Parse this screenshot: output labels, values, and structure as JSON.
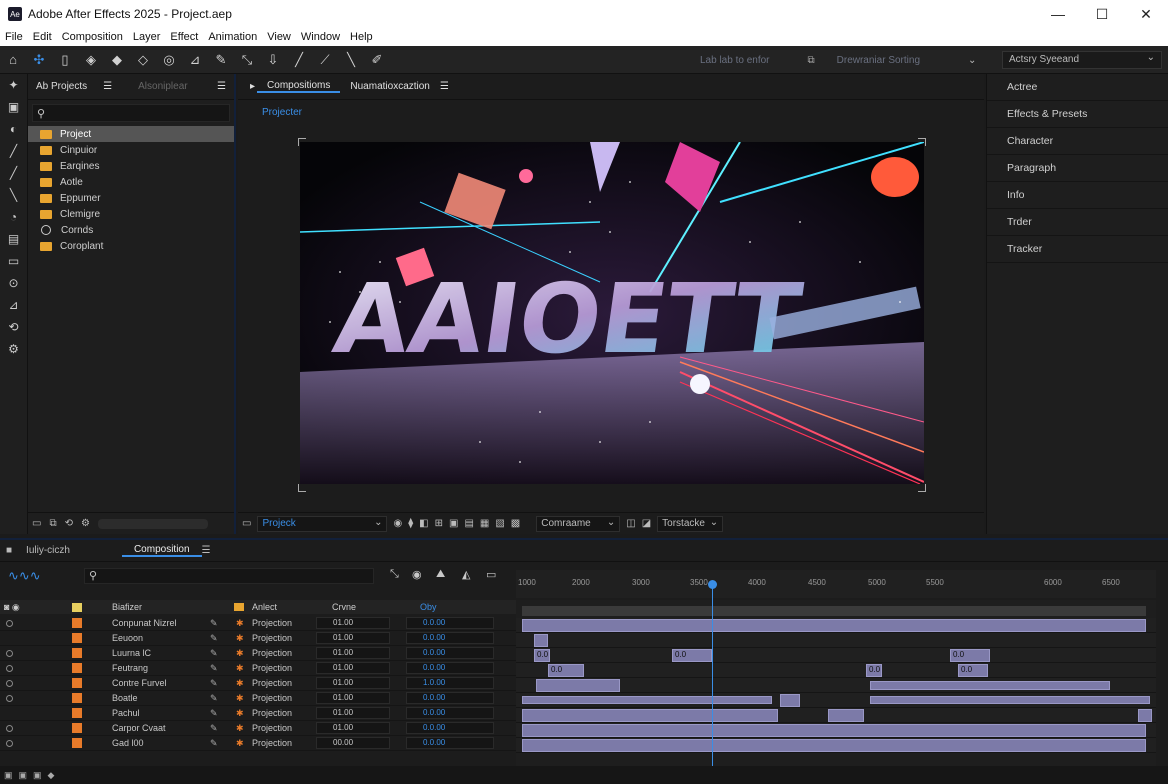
{
  "window": {
    "title": "Adobe After Effects 2025 - Project.aep",
    "logo": "Ae"
  },
  "menu": [
    "File",
    "Edit",
    "Composition",
    "Layer",
    "Effect",
    "Animation",
    "View",
    "Window",
    "Help"
  ],
  "toolbar": {
    "tools": [
      "home-icon",
      "selection-icon",
      "hand-icon",
      "zoom-icon",
      "rotate-icon",
      "camera-icon",
      "pan-behind-icon",
      "rectangle-icon",
      "pen-icon",
      "text-icon",
      "brush-icon",
      "clone-stamp-icon",
      "eraser-icon",
      "roto-brush-icon",
      "puppet-icon"
    ],
    "snap_text": "Lab  lab to enfor",
    "snap_text2": "Drewraniar Sorting",
    "workspace": "Actsry Syeeand"
  },
  "project_panel": {
    "tabs": [
      "Ab Projects",
      "Alsoniplear"
    ],
    "search_placeholder": "",
    "items": [
      {
        "name": "Project",
        "type": "folder",
        "selected": true
      },
      {
        "name": "Cinpuior",
        "type": "folder"
      },
      {
        "name": "Earqines",
        "type": "folder"
      },
      {
        "name": "Aotle",
        "type": "folder"
      },
      {
        "name": "Eppumer",
        "type": "folder"
      },
      {
        "name": "Clemigre",
        "type": "folder"
      },
      {
        "name": "Cornds",
        "type": "circle"
      },
      {
        "name": "Coroplant",
        "type": "folder"
      }
    ]
  },
  "composition_panel": {
    "tabs": [
      "Compositioms",
      "Nuamatioxcaztion"
    ],
    "breadcrumb": "Projecter",
    "bottom": {
      "project_select": "Projeck",
      "comp_select": "Comraame",
      "view_select": "Torstacke"
    }
  },
  "right_panel": {
    "items": [
      "Actree",
      "Effects & Presets",
      "Character",
      "Paragraph",
      "Info",
      "Trder",
      "Tracker"
    ]
  },
  "timeline": {
    "tabs": [
      "Iuliy-ciczh",
      "Composition"
    ],
    "columns": {
      "name": "Biafizer",
      "parent": "Anlect",
      "mode": "Crvne",
      "blend": "Oby"
    },
    "rows": [
      {
        "name": "Conpunat Nizrel",
        "parent": "Projection",
        "mode": "01.00",
        "blend": "0.0.00"
      },
      {
        "name": "Eeuoon",
        "parent": "Projection",
        "mode": "01.00",
        "blend": "0.0.00"
      },
      {
        "name": "Luurna lC",
        "parent": "Projection",
        "mode": "01.00",
        "blend": "0.0.00"
      },
      {
        "name": "Feutrang",
        "parent": "Projection",
        "mode": "01.00",
        "blend": "0.0.00"
      },
      {
        "name": "Contre Furvel",
        "parent": "Projection",
        "mode": "01.00",
        "blend": "1.0.00"
      },
      {
        "name": "Boatle",
        "parent": "Projection",
        "mode": "01.00",
        "blend": "0.0.00"
      },
      {
        "name": "Pachul",
        "parent": "Projection",
        "mode": "01.00",
        "blend": "0.0.00"
      },
      {
        "name": "Carpor Cvaat",
        "parent": "Projection",
        "mode": "01.00",
        "blend": "0.0.00"
      },
      {
        "name": "Gad l00",
        "parent": "Projection",
        "mode": "00.00",
        "blend": "0.0.00"
      }
    ],
    "ruler_ticks": [
      "1000",
      "2000",
      "3000",
      "3500",
      "4000",
      "4500",
      "5000",
      "5500",
      "6000",
      "6500"
    ],
    "clip_labels": [
      "0.0",
      "0.0",
      "0.0",
      "0.0",
      "0.0",
      "0.0"
    ]
  }
}
